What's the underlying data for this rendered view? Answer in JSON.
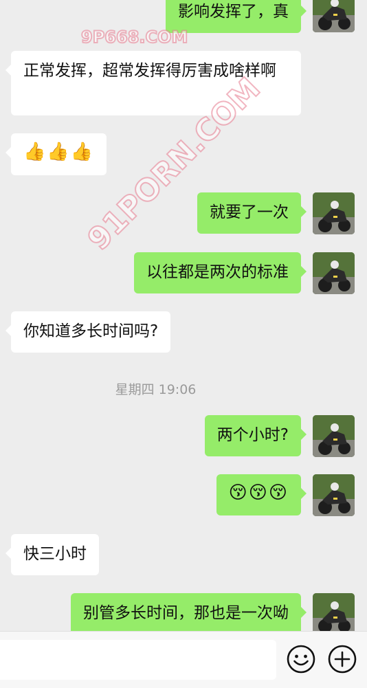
{
  "watermarks": {
    "top": "9P668.COM",
    "diagonal": "91PORN.COM"
  },
  "messages": [
    {
      "side": "out",
      "text": "影响发挥了，真"
    },
    {
      "side": "in",
      "text": "正常发挥，超常发挥得厉害成啥样啊"
    },
    {
      "side": "in",
      "text": "👍👍👍"
    },
    {
      "side": "out",
      "text": "就要了一次"
    },
    {
      "side": "out",
      "text": "以往都是两次的标准"
    },
    {
      "side": "in",
      "text": "你知道多长时间吗?"
    },
    {
      "side": "out",
      "text": "两个小时?"
    },
    {
      "side": "out",
      "text": "😚😚😚"
    },
    {
      "side": "in",
      "text": "快三小时"
    },
    {
      "side": "out",
      "text": "别管多长时间，那也是一次呦"
    }
  ],
  "timestamp": "星期四 19:06",
  "input": {
    "value": "",
    "placeholder": ""
  },
  "icons": {
    "emoji": "smiley-face-icon",
    "more": "plus-circle-icon"
  },
  "colors": {
    "background": "#ededed",
    "outgoing_bubble": "#95ec69",
    "incoming_bubble": "#ffffff"
  }
}
